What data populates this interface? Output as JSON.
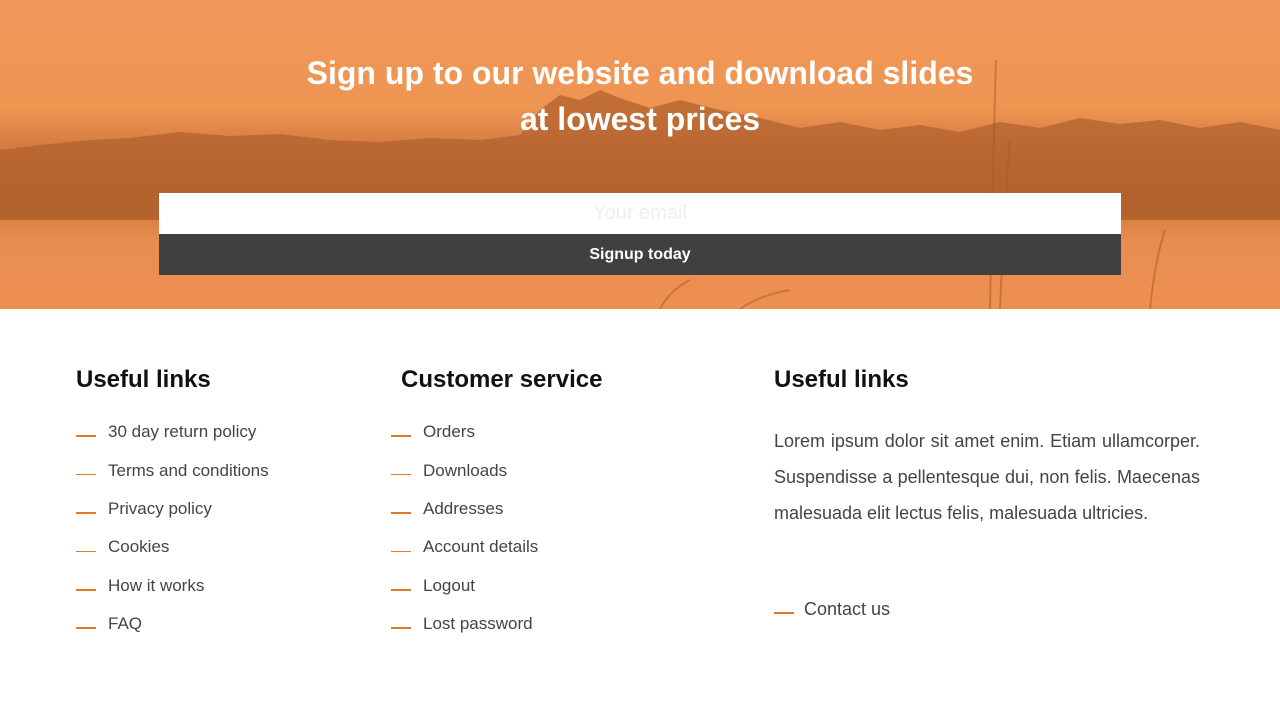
{
  "hero": {
    "title_line1": "Sign up to our website and download slides",
    "title_line2": "at lowest prices",
    "email_placeholder": "Your email",
    "email_value": "",
    "signup_label": "Signup today"
  },
  "colors": {
    "accent": "#e07a2b",
    "button_bg": "#404040",
    "hero_orange": "#ef9552"
  },
  "columns": [
    {
      "title": "Useful links",
      "links": [
        "30 day return policy",
        "Terms and conditions",
        "Privacy policy",
        "Cookies",
        "How it works",
        "FAQ"
      ]
    },
    {
      "title": "Customer service",
      "links": [
        "Orders",
        "Downloads",
        "Addresses",
        "Account details",
        "Logout",
        "Lost password"
      ]
    },
    {
      "title": "Useful links",
      "text": "Lorem ipsum dolor sit amet enim. Etiam ullamcorper. Suspendisse a pellentesque dui, non felis. Maecenas malesuada elit lectus felis, malesuada ultricies.",
      "links": [
        "Contact us"
      ]
    }
  ]
}
